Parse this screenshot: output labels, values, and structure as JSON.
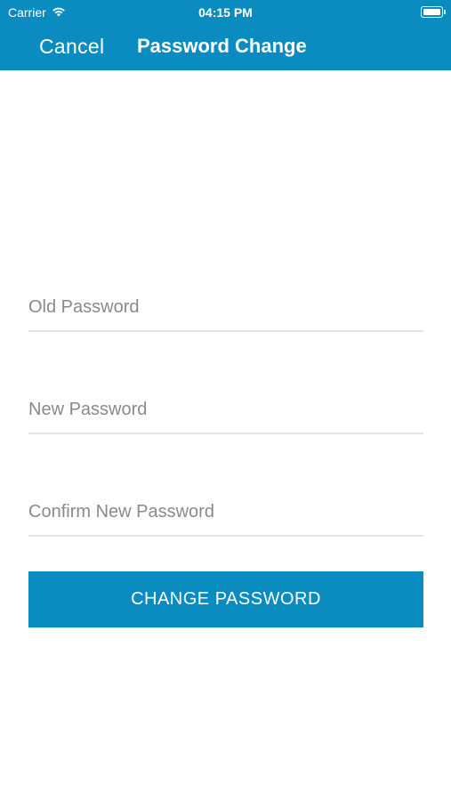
{
  "status_bar": {
    "carrier": "Carrier",
    "time": "04:15 PM",
    "wifi_icon": "wifi-icon",
    "battery_icon": "battery-icon",
    "battery_level": 1.0
  },
  "nav": {
    "cancel_label": "Cancel",
    "title": "Password Change"
  },
  "form": {
    "old_password": {
      "placeholder": "Old Password",
      "value": ""
    },
    "new_password": {
      "placeholder": "New Password",
      "value": ""
    },
    "confirm_password": {
      "placeholder": "Confirm New Password",
      "value": ""
    },
    "submit_label": "CHANGE PASSWORD"
  },
  "colors": {
    "accent": "#0a8cc0",
    "divider": "#e4e4e4",
    "placeholder": "#8a8a8a"
  }
}
